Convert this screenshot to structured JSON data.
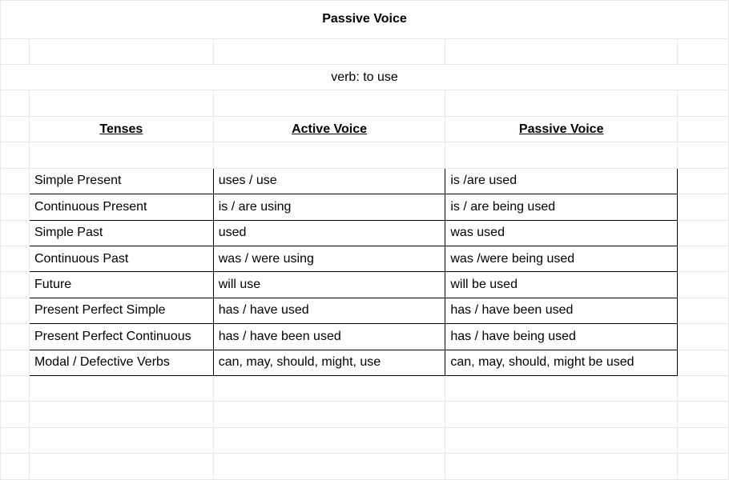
{
  "title": "Passive Voice",
  "verb_line": "verb: to use",
  "headers": {
    "tenses": "Tenses",
    "active": "Active Voice",
    "passive": "Passive Voice"
  },
  "rows": [
    {
      "tense": "Simple Present",
      "active": "uses / use",
      "passive": "is /are used"
    },
    {
      "tense": "Continuous Present",
      "active": "is / are using",
      "passive": "is / are being used"
    },
    {
      "tense": "Simple Past",
      "active": "used",
      "passive": "was used"
    },
    {
      "tense": "Continuous Past",
      "active": "was / were using",
      "passive": "was /were being used"
    },
    {
      "tense": "Future",
      "active": "will use",
      "passive": "will be used"
    },
    {
      "tense": "Present Perfect Simple",
      "active": "has / have used",
      "passive": "has / have been used"
    },
    {
      "tense": "Present Perfect Continuous",
      "active": "has / have been used",
      "passive": "has / have being used"
    },
    {
      "tense": "Modal / Defective Verbs",
      "active": "can, may, should, might, use",
      "passive": "can, may, should, might be used"
    }
  ]
}
